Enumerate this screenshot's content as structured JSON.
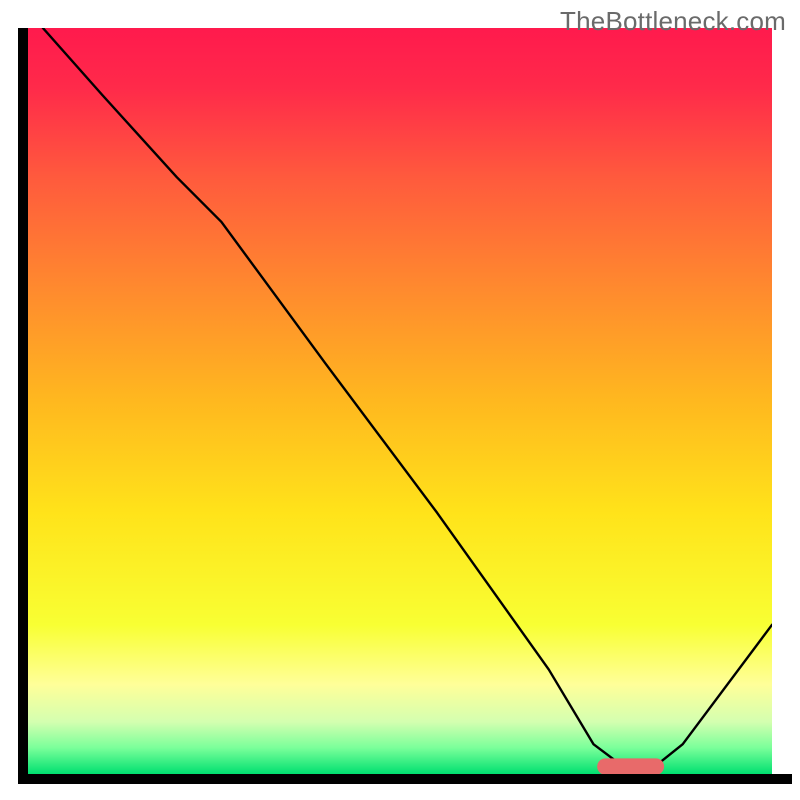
{
  "watermark": "TheBottleneck.com",
  "chart_data": {
    "type": "line",
    "title": "",
    "xlabel": "",
    "ylabel": "",
    "xlim": [
      0,
      100
    ],
    "ylim": [
      0,
      100
    ],
    "background_gradient": [
      {
        "pos": 0.0,
        "color": "#ff1a4d"
      },
      {
        "pos": 0.08,
        "color": "#ff2a4a"
      },
      {
        "pos": 0.2,
        "color": "#ff5a3d"
      },
      {
        "pos": 0.35,
        "color": "#ff8a2e"
      },
      {
        "pos": 0.5,
        "color": "#ffb81f"
      },
      {
        "pos": 0.65,
        "color": "#ffe31a"
      },
      {
        "pos": 0.8,
        "color": "#f8ff33"
      },
      {
        "pos": 0.88,
        "color": "#ffff99"
      },
      {
        "pos": 0.93,
        "color": "#d4ffb0"
      },
      {
        "pos": 0.965,
        "color": "#7aff9a"
      },
      {
        "pos": 1.0,
        "color": "#00e070"
      }
    ],
    "series": [
      {
        "name": "bottleneck-curve",
        "stroke": "#000000",
        "stroke_width": 2.4,
        "x": [
          2.0,
          10.0,
          20.0,
          26.0,
          40.0,
          55.0,
          70.0,
          76.0,
          80.0,
          84.0,
          88.0,
          100.0
        ],
        "y": [
          100.0,
          91.0,
          80.0,
          74.0,
          55.0,
          35.0,
          14.0,
          4.0,
          1.0,
          0.8,
          4.0,
          20.0
        ]
      }
    ],
    "marker": {
      "name": "optimal-zone",
      "shape": "rounded-bar",
      "x_center": 81.0,
      "y_center": 1.0,
      "width": 9.0,
      "height": 2.2,
      "color": "#e86a6a"
    }
  }
}
